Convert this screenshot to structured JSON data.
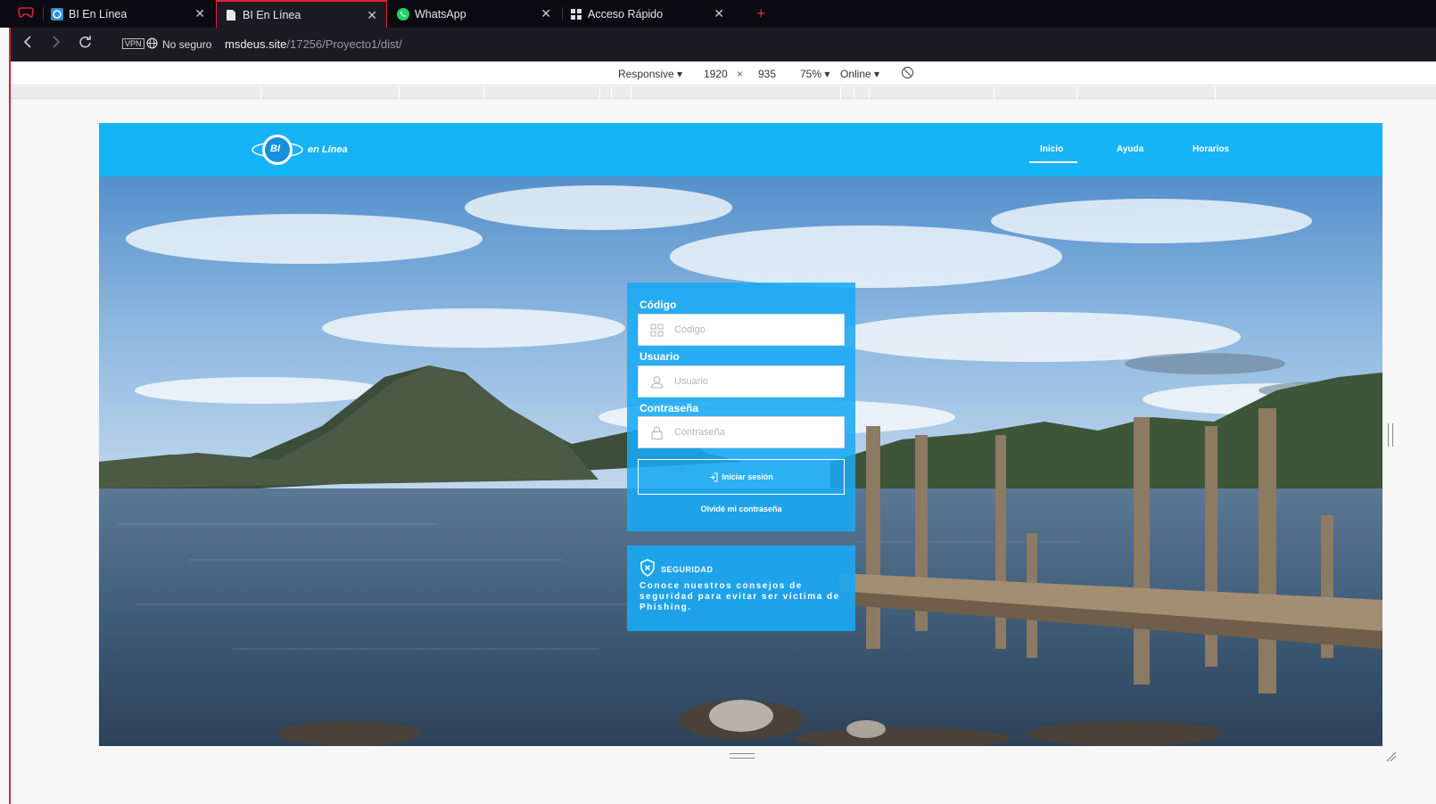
{
  "browser": {
    "tabs": [
      {
        "title": "BI En Línea",
        "icon": "bi-favicon-icon"
      },
      {
        "title": "BI En Línea",
        "icon": "document-icon",
        "active": true
      },
      {
        "title": "WhatsApp",
        "icon": "whatsapp-icon"
      },
      {
        "title": "Acceso Rápido",
        "icon": "grid-icon"
      }
    ],
    "vpn_label": "VPN",
    "security_status": "No seguro",
    "url_host": "msdeus.site",
    "url_path": "/17256/Proyecto1/dist/"
  },
  "device_toolbar": {
    "mode": "Responsive",
    "width": "1920",
    "times": "×",
    "height": "935",
    "zoom": "75%",
    "network": "Online"
  },
  "site": {
    "logo_badge": "BI",
    "logo_text": "en Línea",
    "nav": [
      "Inicio",
      "Ayuda",
      "Horarios"
    ],
    "active_nav": "Inicio",
    "brand_color": "#17b3f7"
  },
  "login": {
    "code_label": "Código",
    "code_placeholder": "Código",
    "user_label": "Usuario",
    "user_placeholder": "Usuario",
    "password_label": "Contraseña",
    "password_placeholder": "Contraseña",
    "submit_label": "Iniciar sesión",
    "forgot_label": "Olvidé mi contraseña"
  },
  "security": {
    "title": "SEGURIDAD",
    "text_before": "Conoce nuestros consejos de seguridad para evitar ser víctima de ",
    "text_bold": "Phishing",
    "text_after": "."
  }
}
